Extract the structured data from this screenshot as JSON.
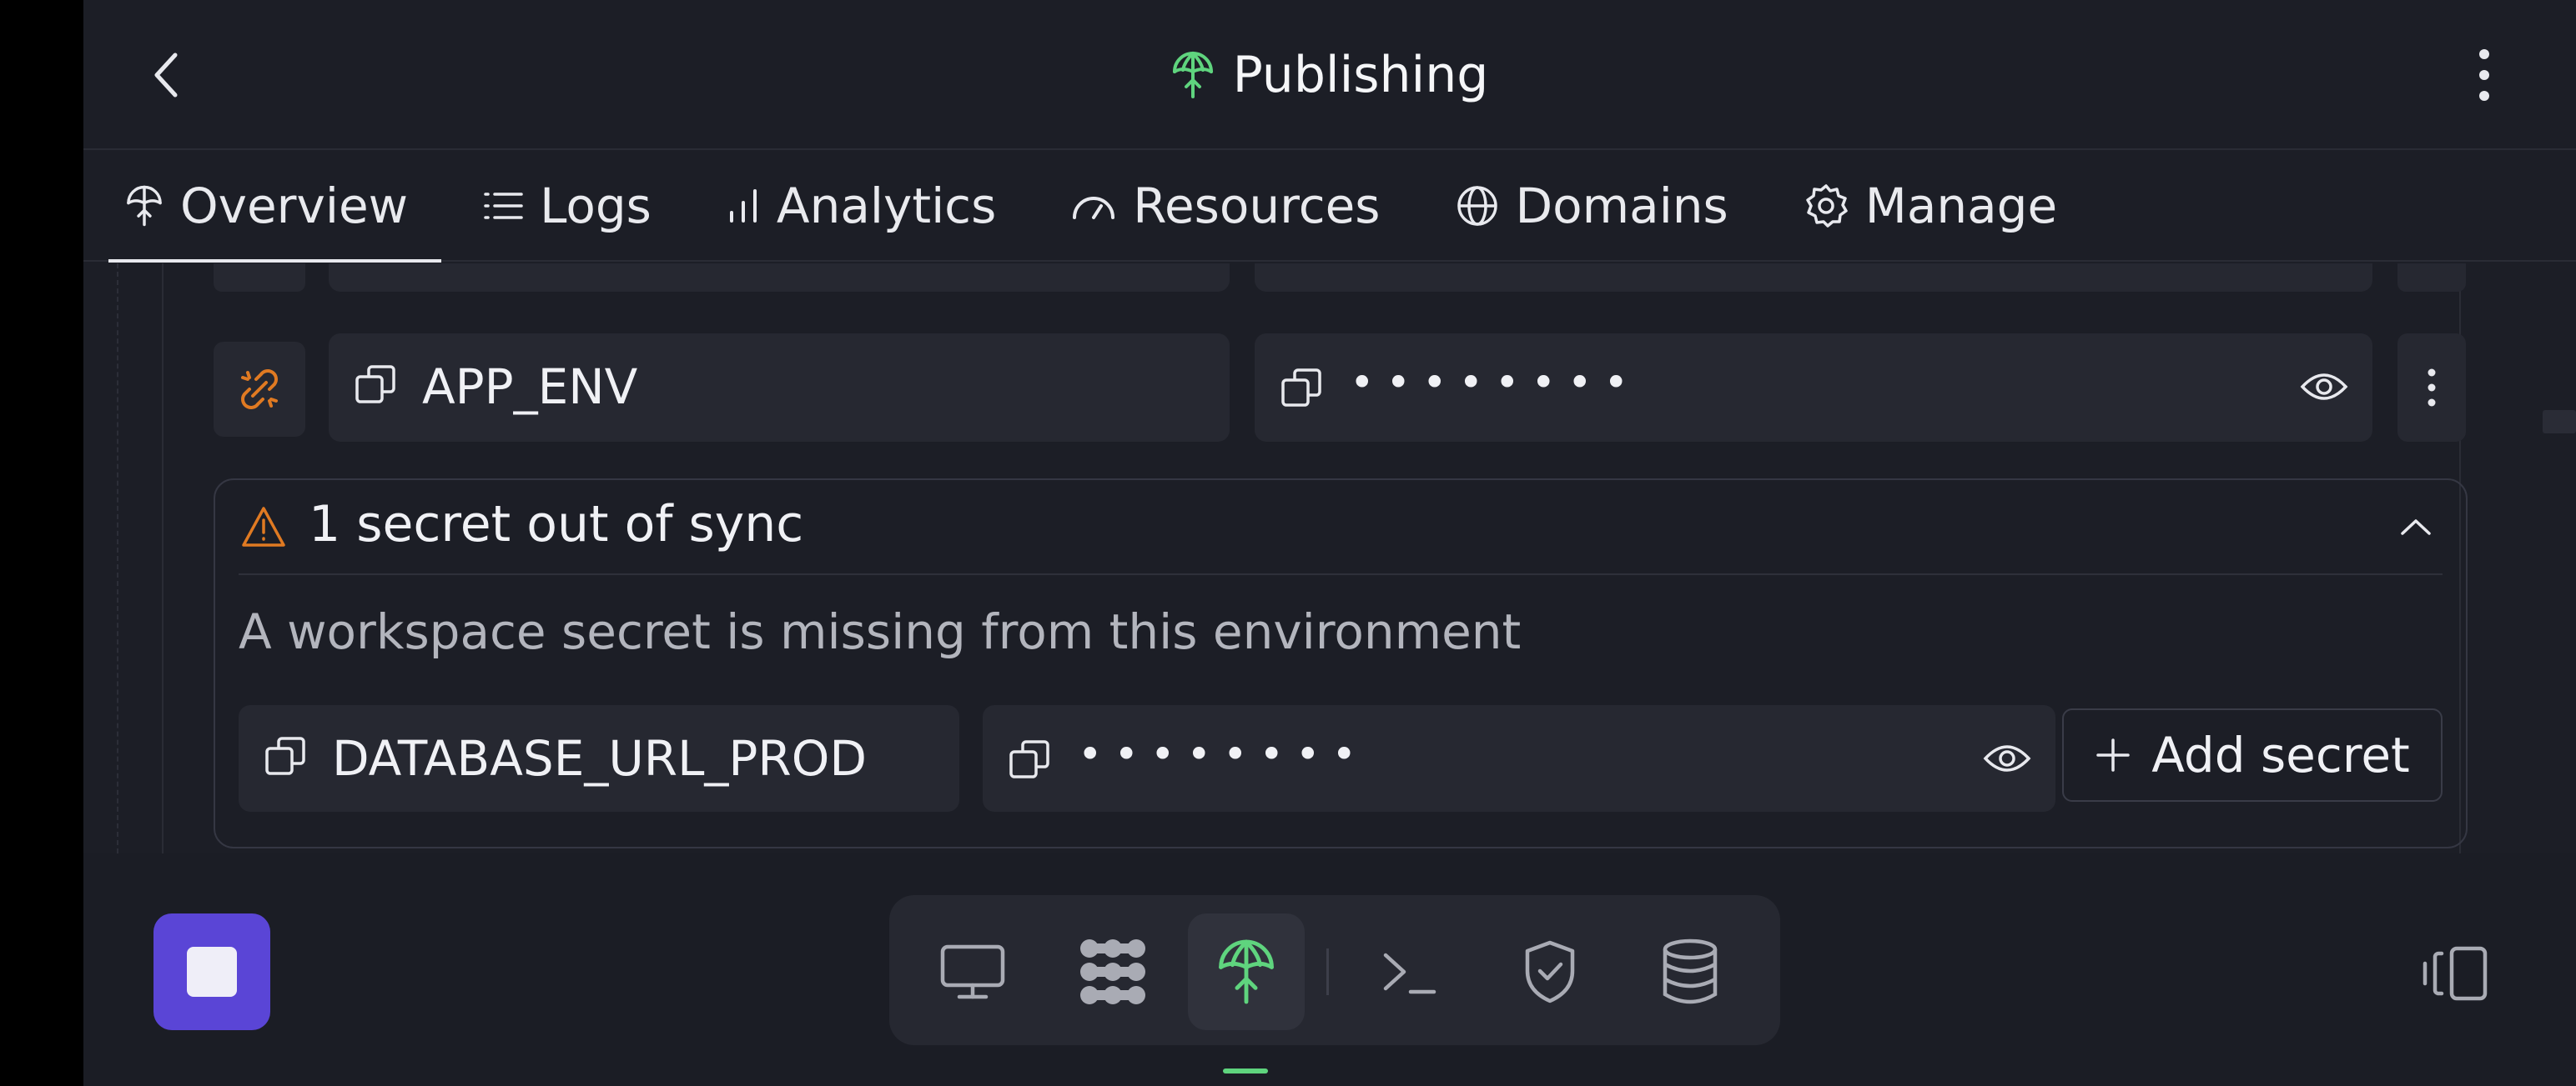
{
  "header": {
    "title": "Publishing",
    "back_icon": "chevron-left-icon",
    "menu_icon": "more-vertical-icon"
  },
  "tabs": [
    {
      "label": "Overview",
      "icon": "publish-icon",
      "active": true
    },
    {
      "label": "Logs",
      "icon": "list-icon",
      "active": false
    },
    {
      "label": "Analytics",
      "icon": "bar-chart-icon",
      "active": false
    },
    {
      "label": "Resources",
      "icon": "gauge-icon",
      "active": false
    },
    {
      "label": "Domains",
      "icon": "globe-icon",
      "active": false
    },
    {
      "label": "Manage",
      "icon": "gear-icon",
      "active": false
    }
  ],
  "secrets": {
    "row": {
      "key": "APP_ENV",
      "value_masked": "••••••••",
      "link_icon": "unlink-icon"
    },
    "sync": {
      "title": "1 secret out of sync",
      "description": "A workspace secret is missing from this environment",
      "missing_key": "DATABASE_URL_PROD",
      "missing_value_masked": "••••••••",
      "add_label": "Add secret"
    }
  },
  "bottom_bar": {
    "stop_icon": "stop-icon",
    "dock_items": [
      {
        "icon": "monitor-icon",
        "active": false
      },
      {
        "icon": "apps-icon",
        "active": false
      },
      {
        "icon": "publish-icon",
        "active": true
      },
      {
        "icon": "terminal-icon",
        "active": false
      },
      {
        "icon": "shield-check-icon",
        "active": false
      },
      {
        "icon": "database-icon",
        "active": false
      }
    ],
    "toggle_icon": "sidebar-toggle-icon"
  },
  "colors": {
    "accent_green": "#5fd47e",
    "warning_orange": "#e07a22",
    "stop_purple": "#5a45d6",
    "background": "#1c1e26"
  }
}
